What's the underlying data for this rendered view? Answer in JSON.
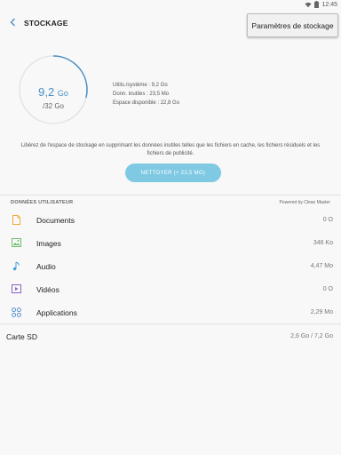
{
  "status_bar": {
    "time": "12:45"
  },
  "app_bar": {
    "title": "STOCKAGE",
    "settings_button": "Paramètres de stockage"
  },
  "storage": {
    "used_value": "9,2",
    "used_unit": "Go",
    "total": "/32 Go",
    "used_fraction": 0.2875,
    "details": [
      "Utilis./système : 9,2 Go",
      "Donn. inutiles : 23,5 Mo",
      "Espace disponible : 22,8 Go"
    ],
    "info_text": "Libérez de l'espace de stockage en supprimant les données inutiles telles que les fichiers en cache, les fichiers résiduels et les fichiers de publicité.",
    "clean_button": "NETTOYER (+ 23,5 MO)"
  },
  "user_data": {
    "header": "DONNÉES UTILISATEUR",
    "powered_by": "Powered by Clean Master",
    "items": [
      {
        "label": "Documents",
        "size": "0 O",
        "icon": "document-icon"
      },
      {
        "label": "Images",
        "size": "346 Ko",
        "icon": "image-icon"
      },
      {
        "label": "Audio",
        "size": "4,47 Mo",
        "icon": "music-note-icon"
      },
      {
        "label": "Vidéos",
        "size": "0 O",
        "icon": "video-icon"
      },
      {
        "label": "Applications",
        "size": "2,29 Mo",
        "icon": "apps-icon"
      }
    ]
  },
  "sd_card": {
    "label": "Carte SD",
    "size": "2,6 Go / 7,2 Go"
  },
  "colors": {
    "accent": "#4a8fc4",
    "button": "#7fc9e3",
    "document": "#f2a93b",
    "image": "#6cbf6a",
    "audio": "#3f9fdc",
    "video": "#8a63c7",
    "apps": "#4a86cf"
  }
}
